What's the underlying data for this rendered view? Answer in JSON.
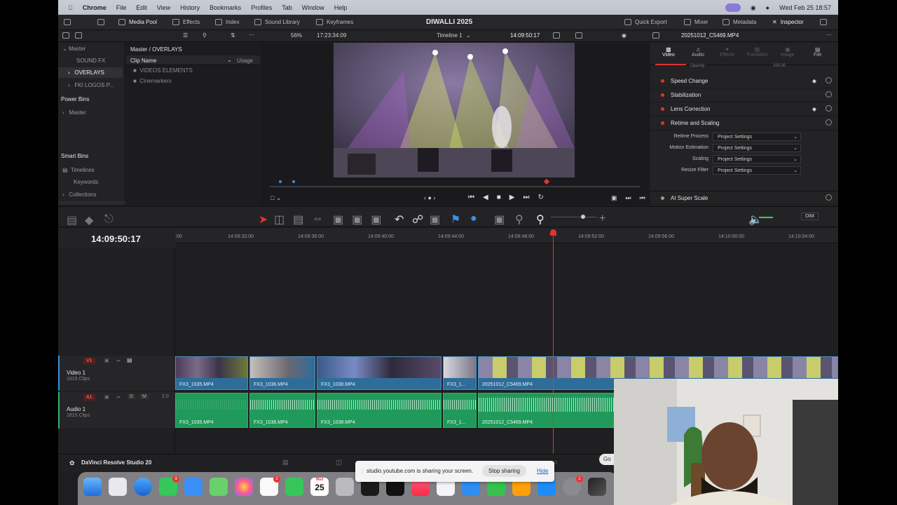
{
  "menubar": {
    "app": "Chrome",
    "items": [
      "File",
      "Edit",
      "View",
      "History",
      "Bookmarks",
      "Profiles",
      "Tab",
      "Window",
      "Help"
    ],
    "datetime": "Wed Feb 25  18:57"
  },
  "toolbar": {
    "media_pool": "Media Pool",
    "effects": "Effects",
    "index": "Index",
    "sound_library": "Sound Library",
    "keyframes": "Keyframes",
    "project_title": "DIWALLI 2025",
    "quick_export": "Quick Export",
    "mixer": "Mixer",
    "metadata": "Metadata",
    "inspector": "Inspector"
  },
  "viewer_bar": {
    "zoom": "56%",
    "source_timecode": "17:23:34:09",
    "timeline_name": "Timeline 1",
    "record_timecode": "14:09:50:17",
    "clip_name": "20251012_C5469.MP4"
  },
  "bins": {
    "master": "Master",
    "items": [
      "SOUND FX",
      "OVERLAYS",
      "FKI LOGOS P..."
    ],
    "power_bins": "Power Bins",
    "power_master": "Master",
    "smart_bins": "Smart Bins",
    "smart_items": [
      "Timelines",
      "Keywords",
      "Collections"
    ]
  },
  "clips": {
    "path": "Master / OVERLAYS",
    "col_name": "Clip Name",
    "col_usage": "Usage",
    "folders": [
      "VIDEOS ELEMENTS",
      "Cinemarkers"
    ]
  },
  "inspector": {
    "tabs": [
      "Video",
      "Audio",
      "Effects",
      "Transition",
      "Image",
      "File"
    ],
    "opacity_label": "Opacity",
    "opacity_value": "100.00",
    "sections": [
      "Speed Change",
      "Stabilization",
      "Lens Correction",
      "Retime and Scaling"
    ],
    "retime_rows": [
      {
        "label": "Retime Process",
        "value": "Project Settings"
      },
      {
        "label": "Motion Estimation",
        "value": "Project Settings"
      },
      {
        "label": "Scaling",
        "value": "Project Settings"
      },
      {
        "label": "Resize Filter",
        "value": "Project Settings"
      }
    ],
    "ai_super_scale": "AI Super Scale"
  },
  "timeline": {
    "timecode": "14:09:50:17",
    "dim": "DIM",
    "ruler": [
      "14:09:32:00",
      "14:09:36:00",
      "14:09:40:00",
      "14:09:44:00",
      "14:09:48:00",
      "14:09:52:00",
      "14:09:56:00",
      "14:10:00:00",
      "14:10:04:00"
    ],
    "ruler_first": ":00",
    "v1": {
      "tag": "V1",
      "name": "Video 1",
      "count": "1615 Clips"
    },
    "a1": {
      "tag": "A1",
      "name": "Audio 1",
      "count": "1615 Clips",
      "level": "2.0",
      "solo": "S",
      "mute": "M"
    },
    "video_clips": [
      "FX3_1035.MP4",
      "FX3_1036.MP4",
      "FX3_1038.MP4",
      "FX3_1...",
      "20251012_C5469.MP4"
    ],
    "audio_clips": [
      "FX3_1035.MP4",
      "FX3_1036.MP4",
      "FX3_1038.MP4",
      "FX3_1...",
      "20251012_C5469.MP4"
    ]
  },
  "footer": {
    "app_name": "DaVinci Resolve Studio 20",
    "share_text": "studio.youtube.com is sharing your screen.",
    "stop_sharing": "Stop sharing",
    "hide": "Hide",
    "calendar_month": "Wed",
    "calendar_day": "25",
    "go_partial": "Go"
  }
}
